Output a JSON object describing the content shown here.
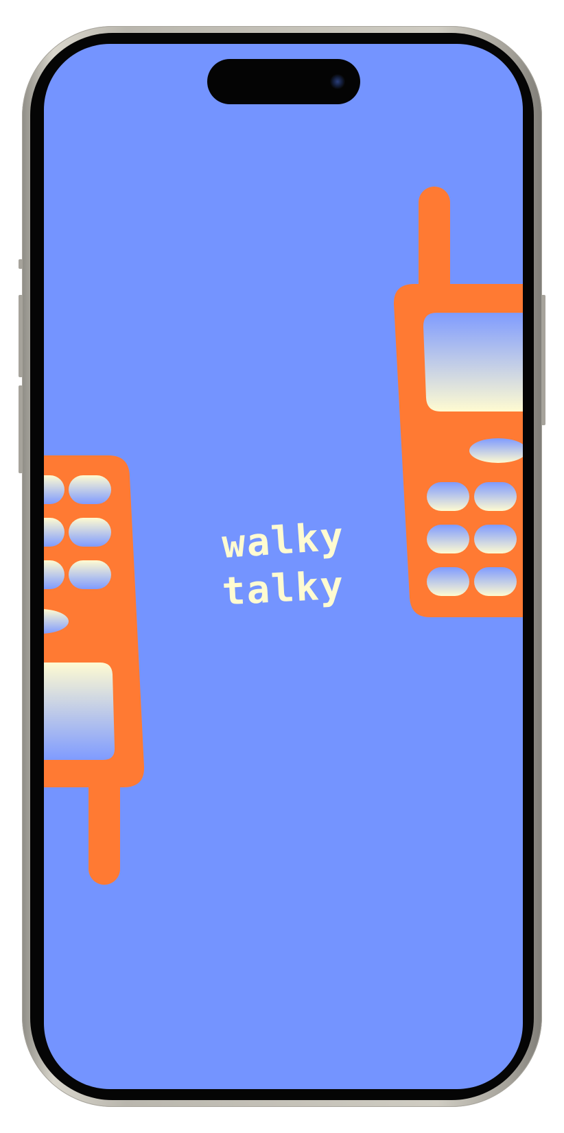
{
  "wallpaper": {
    "title_line1": "walky",
    "title_line2": "talky",
    "colors": {
      "background": "#7494ff",
      "radio_body": "#ff7a33",
      "title_text": "#fffbd1",
      "gradient_light": "#fffbd1",
      "gradient_blue": "#7494ff"
    }
  },
  "device": {
    "icons": {
      "camera": "front-camera-icon",
      "dynamic_island": "dynamic-island"
    }
  }
}
